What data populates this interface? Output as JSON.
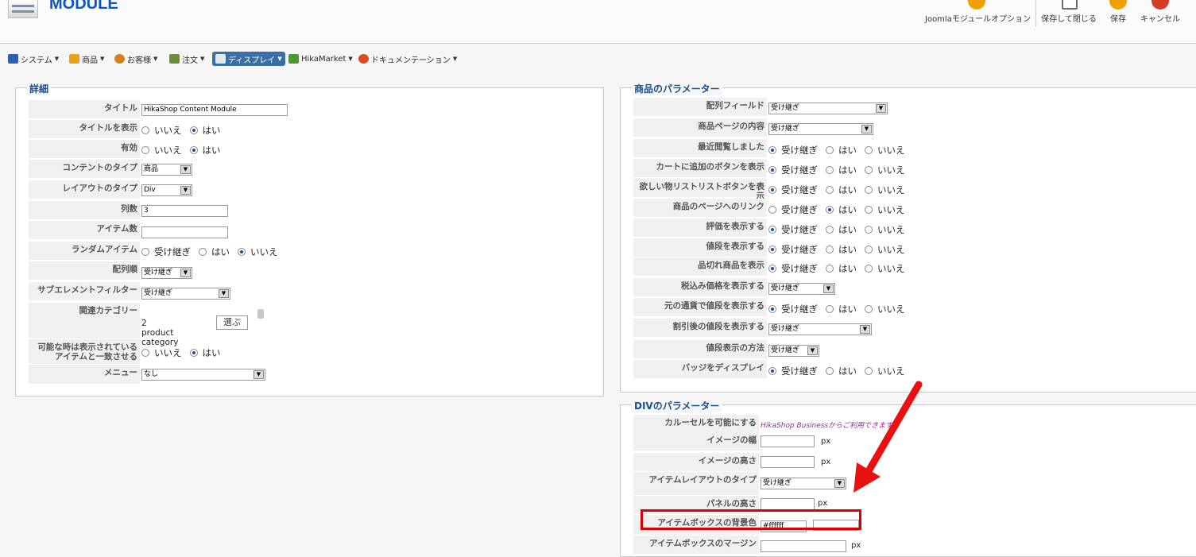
{
  "header": {
    "title": "MODULE",
    "toolbar": [
      {
        "name": "joomla-options-button",
        "label": "Joomlaモジュールオプション",
        "icon": "gear-icon",
        "color": "#f0a000"
      },
      {
        "name": "save-close-button",
        "label": "保存して閉じる",
        "icon": "save-close-icon",
        "color": "#6c6c6c"
      },
      {
        "name": "save-button",
        "label": "保存",
        "icon": "checkmark-icon",
        "color": "#f0a000"
      },
      {
        "name": "cancel-button",
        "label": "キャンセル",
        "icon": "cancel-icon",
        "color": "#d33c25"
      }
    ]
  },
  "menu": [
    {
      "label": "システム",
      "icon": "wrench-icon",
      "color": "#3060b0"
    },
    {
      "label": "商品",
      "icon": "folder-icon",
      "color": "#e8a21a"
    },
    {
      "label": "お客様",
      "icon": "user-icon",
      "color": "#d4801e"
    },
    {
      "label": "注文",
      "icon": "cart-icon",
      "color": "#6a8f3c"
    },
    {
      "label": "ディスプレイ",
      "icon": "display-icon",
      "color": "#3a6ea5"
    },
    {
      "label": "HikaMarket",
      "icon": "hikamarket-icon",
      "color": "#4a9a2f"
    },
    {
      "label": "ドキュメンテーション",
      "icon": "lifebuoy-icon",
      "color": "#d84a20"
    }
  ],
  "details": {
    "legend": "詳細",
    "title_label": "タイトル",
    "title_value": "HikaShop Content Module",
    "show_title_label": "タイトルを表示",
    "enabled_label": "有効",
    "content_type_label": "コンテントのタイプ",
    "content_type_value": "商品",
    "layout_type_label": "レイアウトのタイプ",
    "layout_type_value": "Div",
    "columns_label": "列数",
    "columns_value": "3",
    "items_label": "アイテム数",
    "items_value": "",
    "random_label": "ランダムアイテム",
    "order_label": "配列順",
    "order_value": "受け継ぎ",
    "subfilter_label": "サブエレメントフィルター",
    "subfilter_value": "受け継ぎ",
    "category_label": "関連カテゴリー",
    "category_value": "2 product category",
    "select_button": "選ぶ",
    "sync_label": "可能な時は表示されている アイテムと一致させる",
    "menu_label": "メニュー",
    "menu_value": "なし",
    "opt_no": "いいえ",
    "opt_yes": "はい",
    "opt_inherit": "受け継ぎ"
  },
  "product_params": {
    "legend": "商品のパラメーター",
    "rows": [
      {
        "label": "配列フィールド",
        "type": "select",
        "value": "受け継ぎ"
      },
      {
        "label": "商品ページの内容",
        "type": "select",
        "value": "受け継ぎ"
      },
      {
        "label": "最近閲覧しました",
        "type": "radio",
        "selected": 0
      },
      {
        "label": "カートに追加のボタンを表示",
        "type": "radio",
        "selected": 0
      },
      {
        "label": "欲しい物リストリストボタンを表示",
        "type": "radio",
        "selected": 0
      },
      {
        "label": "商品のページへのリンク",
        "type": "radio",
        "selected": 1
      },
      {
        "label": "評価を表示する",
        "type": "radio",
        "selected": 0
      },
      {
        "label": "値段を表示する",
        "type": "radio",
        "selected": 0
      },
      {
        "label": "品切れ商品を表示",
        "type": "radio",
        "selected": 0
      },
      {
        "label": "税込み価格を表示する",
        "type": "select",
        "value": "受け継ぎ"
      },
      {
        "label": "元の通貨で値段を表示する",
        "type": "radio",
        "selected": 0
      },
      {
        "label": "割引後の値段を表示する",
        "type": "select",
        "value": "受け継ぎ"
      },
      {
        "label": "値段表示の方法",
        "type": "select",
        "value": "受け継ぎ"
      },
      {
        "label": "バッジをディスプレイ",
        "type": "radio",
        "selected": 0
      }
    ],
    "radio_options": [
      "受け継ぎ",
      "はい",
      "いいえ"
    ]
  },
  "div_params": {
    "legend": "DIVのパラメーター",
    "carousel_label": "カルーセルを可能にする",
    "carousel_note": "HikaShop Businessからご利用できます",
    "image_width_label": "イメージの幅",
    "image_height_label": "イメージの高さ",
    "item_layout_label": "アイテムレイアウトのタイプ",
    "item_layout_value": "受け継ぎ",
    "panel_height_label": "パネルの高さ",
    "box_bg_label": "アイテムボックスの背景色",
    "box_bg_value": "#ffffff",
    "box_margin_label": "アイテムボックスのマージン",
    "px": "px"
  },
  "colors": {
    "accent": "#1b4f8a",
    "arrow": "#e81010",
    "highlight": "#d80000"
  }
}
